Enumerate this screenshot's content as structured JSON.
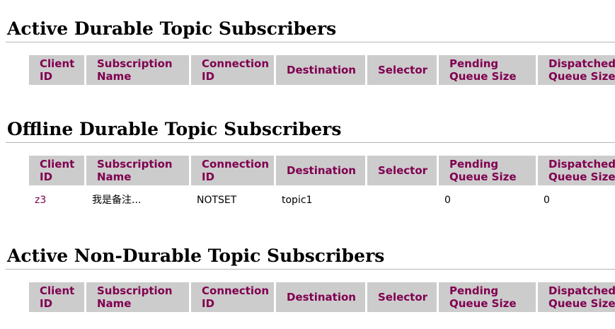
{
  "columns": [
    "Client\nID",
    "Subscription\nName",
    "Connection\nID",
    "Destination",
    "Selector",
    "Pending\nQueue Size",
    "Dispatched\nQueue Size"
  ],
  "sections": [
    {
      "title": "Active Durable Topic Subscribers",
      "rows": []
    },
    {
      "title": "Offline Durable Topic Subscribers",
      "rows": [
        {
          "client_id": "z3",
          "subscription_name": "我是备注...",
          "connection_id": "NOTSET",
          "destination": "topic1",
          "selector": "",
          "pending_queue_size": "0",
          "dispatched_queue_size": "0"
        }
      ]
    },
    {
      "title": "Active Non-Durable Topic Subscribers",
      "rows": []
    }
  ],
  "colors": {
    "header_bg": "#cccccc",
    "header_text": "#800050",
    "link": "#800050"
  }
}
